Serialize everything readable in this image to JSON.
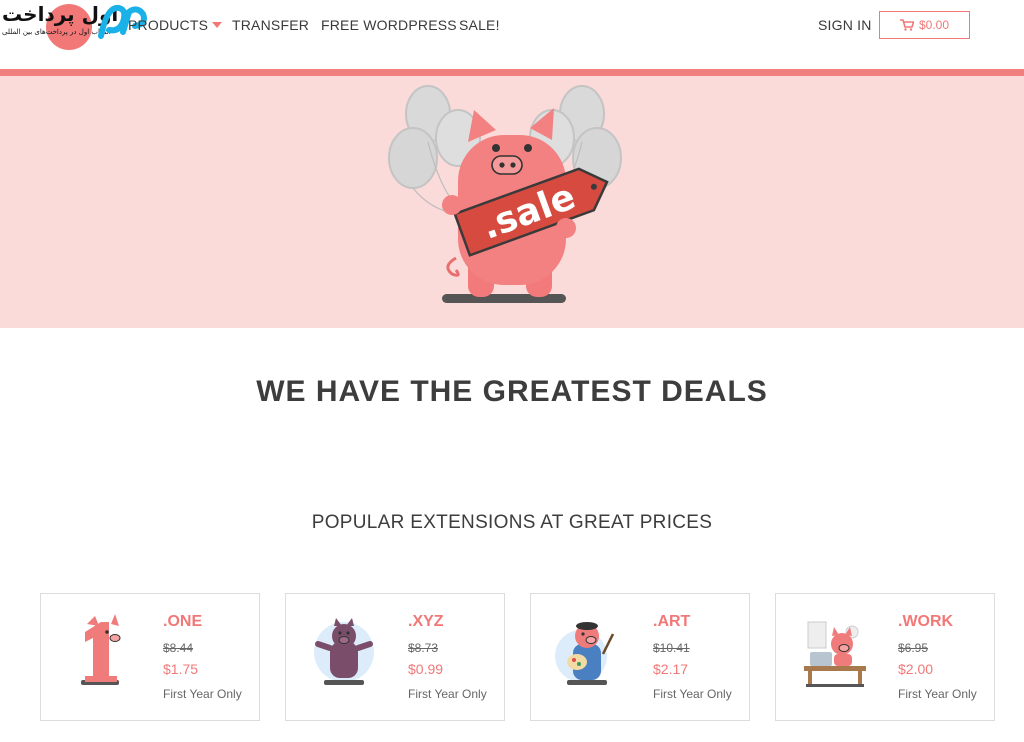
{
  "logo": {
    "brand": "اول پرداخت",
    "tagline": "انتخاب اول در پرداخت‌های بین المللی",
    "colors": {
      "circle": "#f27878",
      "mark": "#1ab0e8"
    }
  },
  "nav": {
    "products": "PRODUCTS",
    "transfer": "TRANSFER",
    "free_wordpress": "FREE WORDPRESS",
    "sale": "SALE!",
    "sign_in": "SIGN IN"
  },
  "cart": {
    "icon": "cart-icon",
    "total": "$0.00"
  },
  "hero": {
    "badge_text": ".sale",
    "background": "#fadbd9",
    "accent": "#f17f80"
  },
  "headings": {
    "main": "WE HAVE THE GREATEST DEALS",
    "sub": "POPULAR EXTENSIONS AT GREAT PRICES"
  },
  "extensions": [
    {
      "name": ".ONE",
      "old_price": "$8.44",
      "new_price": "$1.75",
      "note": "First Year Only"
    },
    {
      "name": ".XYZ",
      "old_price": "$8.73",
      "new_price": "$0.99",
      "note": "First Year Only"
    },
    {
      "name": ".ART",
      "old_price": "$10.41",
      "new_price": "$2.17",
      "note": "First Year Only"
    },
    {
      "name": ".WORK",
      "old_price": "$6.95",
      "new_price": "$2.00",
      "note": "First Year Only"
    }
  ]
}
